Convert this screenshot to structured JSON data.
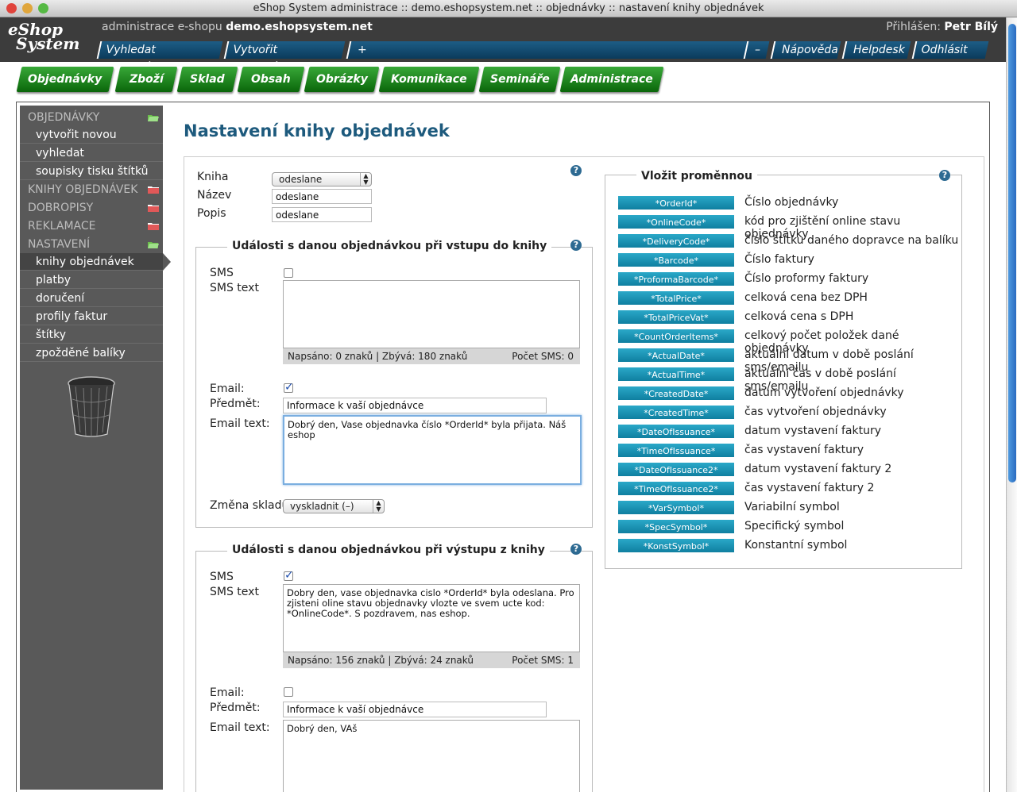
{
  "window": {
    "title": "eShop System administrace :: demo.eshopsystem.net :: objednávky :: nastavení knihy objednávek"
  },
  "header": {
    "logo_line1": "eShop",
    "logo_line2": "System",
    "admin_prefix": "administrace e-shopu ",
    "admin_domain": "demo.eshopsystem.net",
    "logged_prefix": "Přihlášen: ",
    "logged_user": "Petr Bílý",
    "left_tabs": [
      "Vyhledat objednávku",
      "Vytvořit objednávku",
      "+"
    ],
    "right_tabs": [
      "–",
      "Nápověda",
      "Helpdesk",
      "Odhlásit se"
    ]
  },
  "mainnav": [
    "Objednávky",
    "Zboží",
    "Sklad",
    "Obsah",
    "Obrázky",
    "Komunikace",
    "Semináře",
    "Administrace"
  ],
  "sidebar": {
    "sec_orders": "OBJEDNÁVKY",
    "create_new": "vytvořit novou",
    "search": "vyhledat",
    "label_lists": "soupisky tisku štítků",
    "sec_books": "KNIHY OBJEDNÁVEK",
    "sec_credit": "DOBROPISY",
    "sec_claims": "REKLAMACE",
    "sec_settings": "NASTAVENÍ",
    "books": "knihy objednávek",
    "payments": "platby",
    "deliveries": "doručení",
    "invoice_profiles": "profily faktur",
    "labels": "štítky",
    "delayed": "zpožděné balíky"
  },
  "page": {
    "title": "Nastavení knihy objednávek"
  },
  "book": {
    "kniha_label": "Kniha",
    "kniha_value": "odeslane",
    "nazev_label": "Název",
    "nazev_value": "odeslane",
    "popis_label": "Popis",
    "popis_value": "odeslane"
  },
  "entry": {
    "legend": "Události s danou objednávkou při vstupu do knihy",
    "sms_label": "SMS",
    "sms_text_label": "SMS text",
    "sms_text": "",
    "counter_left": "Napsáno: 0 znaků | Zbývá: 180 znaků",
    "counter_right": "Počet SMS: 0",
    "email_label": "Email:",
    "subject_label": "Předmět:",
    "subject_value": "Informace k vaší objednávce",
    "email_text_label": "Email text:",
    "email_text": "Dobrý den, Vase objednavka číslo *OrderId* byla přijata. Náš eshop",
    "stock_label": "Změna skladu",
    "stock_value": "vyskladnit (–)"
  },
  "exit": {
    "legend": "Události s danou objednávkou při výstupu z knihy",
    "sms_label": "SMS",
    "sms_text_label": "SMS text",
    "sms_text": "Dobry den, vase objednavka cislo *OrderId* byla odeslana. Pro\nzjisteni oline stavu objednavky vlozte ve svem ucte kod:\n*OnlineCode*. S pozdravem, nas eshop.",
    "counter_left": "Napsáno: 156 znaků | Zbývá: 24 znaků",
    "counter_right": "Počet SMS: 1",
    "email_label": "Email:",
    "subject_label": "Předmět:",
    "subject_value": "Informace k vaší objednávce",
    "email_text_label": "Email text:",
    "email_text": "Dobrý den, VAš"
  },
  "vars": {
    "legend": "Vložit proměnnou",
    "items": [
      {
        "code": "*OrderId*",
        "desc": "Číslo objednávky"
      },
      {
        "code": "*OnlineCode*",
        "desc": "kód pro zjištění online stavu objednávky"
      },
      {
        "code": "*DeliveryCode*",
        "desc": "číslo štítku daného dopravce na balíku"
      },
      {
        "code": "*Barcode*",
        "desc": "Číslo faktury"
      },
      {
        "code": "*ProformaBarcode*",
        "desc": "Číslo proformy faktury"
      },
      {
        "code": "*TotalPrice*",
        "desc": "celková cena bez DPH"
      },
      {
        "code": "*TotalPriceVat*",
        "desc": "celková cena s DPH"
      },
      {
        "code": "*CountOrderItems*",
        "desc": "celkový počet položek dané objednávky"
      },
      {
        "code": "*ActualDate*",
        "desc": "aktuální datum v době poslání sms/emailu"
      },
      {
        "code": "*ActualTime*",
        "desc": "aktuální čas v době poslání sms/emailu"
      },
      {
        "code": "*CreatedDate*",
        "desc": "datum vytvoření objednávky"
      },
      {
        "code": "*CreatedTime*",
        "desc": "čas vytvoření objednávky"
      },
      {
        "code": "*DateOfIssuance*",
        "desc": "datum vystavení faktury"
      },
      {
        "code": "*TimeOfIssuance*",
        "desc": "čas vystavení faktury"
      },
      {
        "code": "*DateOfIssuance2*",
        "desc": "datum vystavení faktury 2"
      },
      {
        "code": "*TimeOfIssuance2*",
        "desc": "čas vystavení faktury 2"
      },
      {
        "code": "*VarSymbol*",
        "desc": "Variabilní symbol"
      },
      {
        "code": "*SpecSymbol*",
        "desc": "Specifický symbol"
      },
      {
        "code": "*KonstSymbol*",
        "desc": "Konstantní symbol"
      }
    ]
  },
  "help_glyph": "?"
}
